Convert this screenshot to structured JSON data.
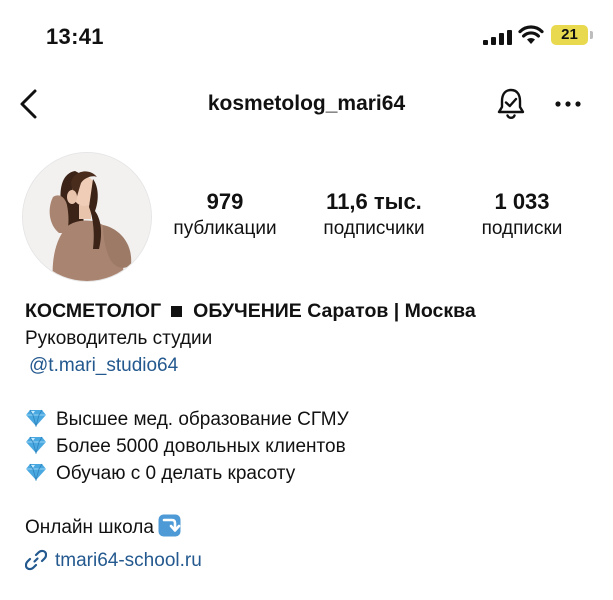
{
  "status_bar": {
    "time": "13:41",
    "battery": "21"
  },
  "nav": {
    "username": "kosmetolog_mari64"
  },
  "stats": {
    "posts": {
      "value": "979",
      "label": "публикации"
    },
    "followers": {
      "value": "11,6 тыс.",
      "label": "подписчики"
    },
    "following": {
      "value": "1 033",
      "label": "подписки"
    }
  },
  "bio": {
    "title_left": "КОСМЕТОЛОГ",
    "title_right": "ОБУЧЕНИЕ Саратов | Москва",
    "role": "Руководитель студии",
    "mention": "@t.mari_studio64",
    "bullets": [
      "Высшее мед. образование СГМУ",
      "Более 5000 довольных клиентов",
      "Обучаю с 0 делать красоту"
    ],
    "school_line": "Онлайн школа",
    "link": "tmari64-school.ru"
  },
  "icons": {
    "bullet": "gem-icon",
    "school": "arrow-down-right-icon",
    "link": "link-icon"
  },
  "colors": {
    "link": "#24598f",
    "battery": "#e8d94e",
    "gem": "#4aa8e0"
  }
}
